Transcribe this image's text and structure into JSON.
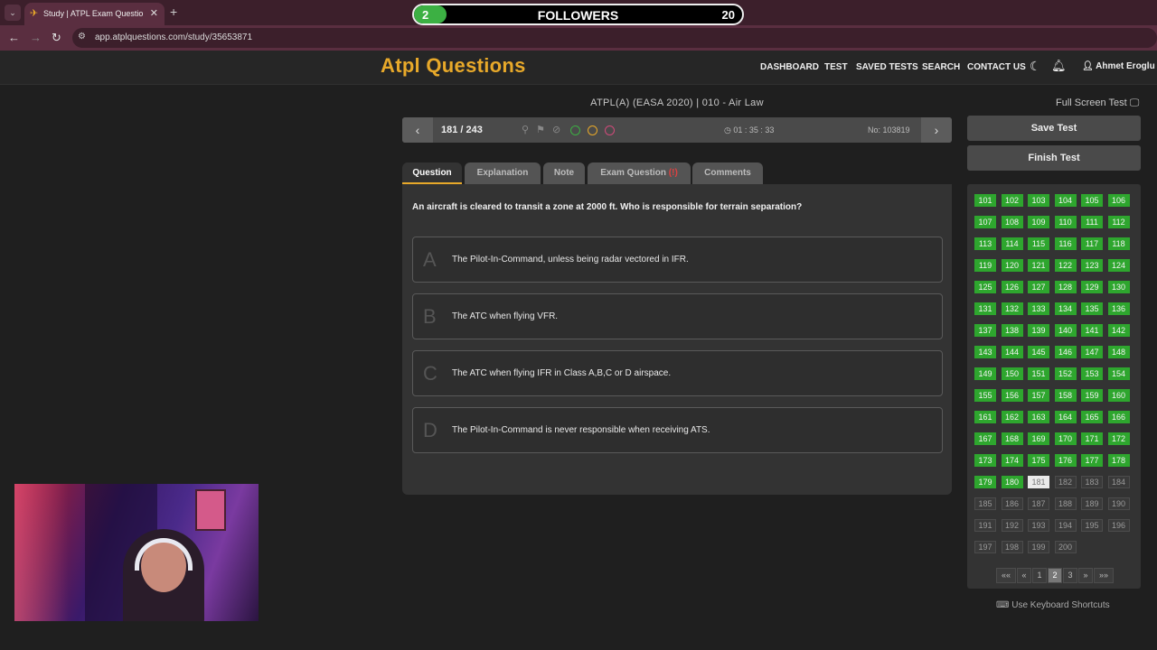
{
  "browser": {
    "tab_title": "Study | ATPL Exam Question Ba",
    "url": "app.atplquestions.com/study/35653871",
    "icons": [
      "back-arrow-icon",
      "forward-arrow-icon",
      "reload-icon",
      "site-info-icon",
      "tab-close-icon",
      "new-tab-icon",
      "tab-dropdown-icon"
    ]
  },
  "followers_goal": {
    "current": "2",
    "label": "FOLLOWERS",
    "goal": "20",
    "progress": 0.1,
    "color": "#3cb043"
  },
  "header": {
    "logo": "Atpl Questions",
    "brand_color": "#e8a92a",
    "menu": [
      "DASHBOARD",
      "TEST",
      "SAVED TESTS",
      "SEARCH",
      "CONTACT US"
    ],
    "user_name": "Ahmet Eroglu",
    "icons": [
      "dark-mode-moon-icon",
      "notification-bell-icon",
      "user-icon"
    ]
  },
  "quiz": {
    "subject": "ATPL(A) (EASA 2020) | 010 - Air Law",
    "position": "181 / 243",
    "timer": "01 : 35 : 33",
    "question_no": "No: 103819",
    "marker_colors": [
      "#3cb043",
      "#e8a92a",
      "#d04a7a"
    ],
    "tabs": [
      {
        "label": "Question",
        "badge": ""
      },
      {
        "label": "Explanation",
        "badge": ""
      },
      {
        "label": "Note",
        "badge": ""
      },
      {
        "label": "Exam Question",
        "badge": "(!)"
      },
      {
        "label": "Comments",
        "badge": ""
      }
    ],
    "question": "An aircraft is cleared to transit a zone at 2000 ft. Who is responsible for terrain separation?",
    "options": [
      {
        "letter": "A",
        "text": "The Pilot-In-Command, unless being radar vectored in IFR."
      },
      {
        "letter": "B",
        "text": "The ATC when flying VFR."
      },
      {
        "letter": "C",
        "text": "The ATC when flying IFR in Class A,B,C or D airspace."
      },
      {
        "letter": "D",
        "text": "The Pilot-In-Command is never responsible when receiving ATS."
      }
    ]
  },
  "sidebar": {
    "full_screen": "Full Screen Test",
    "save_test": "Save Test",
    "finish_test": "Finish Test",
    "answered_color": "#2ea62e",
    "grid": [
      "101",
      "102",
      "103",
      "104",
      "105",
      "106",
      "107",
      "108",
      "109",
      "110",
      "111",
      "112",
      "113",
      "114",
      "115",
      "116",
      "117",
      "118",
      "119",
      "120",
      "121",
      "122",
      "123",
      "124",
      "125",
      "126",
      "127",
      "128",
      "129",
      "130",
      "131",
      "132",
      "133",
      "134",
      "135",
      "136",
      "137",
      "138",
      "139",
      "140",
      "141",
      "142",
      "143",
      "144",
      "145",
      "146",
      "147",
      "148",
      "149",
      "150",
      "151",
      "152",
      "153",
      "154",
      "155",
      "156",
      "157",
      "158",
      "159",
      "160",
      "161",
      "162",
      "163",
      "164",
      "165",
      "166",
      "167",
      "168",
      "169",
      "170",
      "171",
      "172",
      "173",
      "174",
      "175",
      "176",
      "177",
      "178",
      "179",
      "180",
      "181",
      "182",
      "183",
      "184",
      "185",
      "186",
      "187",
      "188",
      "189",
      "190",
      "191",
      "192",
      "193",
      "194",
      "195",
      "196",
      "197",
      "198",
      "199",
      "200"
    ],
    "answered_through": 180,
    "current": 181,
    "pagination": [
      "««",
      "«",
      "1",
      "2",
      "3",
      "»",
      "»»"
    ],
    "active_page": "2",
    "keyboard_shortcuts": "Use Keyboard Shortcuts"
  }
}
